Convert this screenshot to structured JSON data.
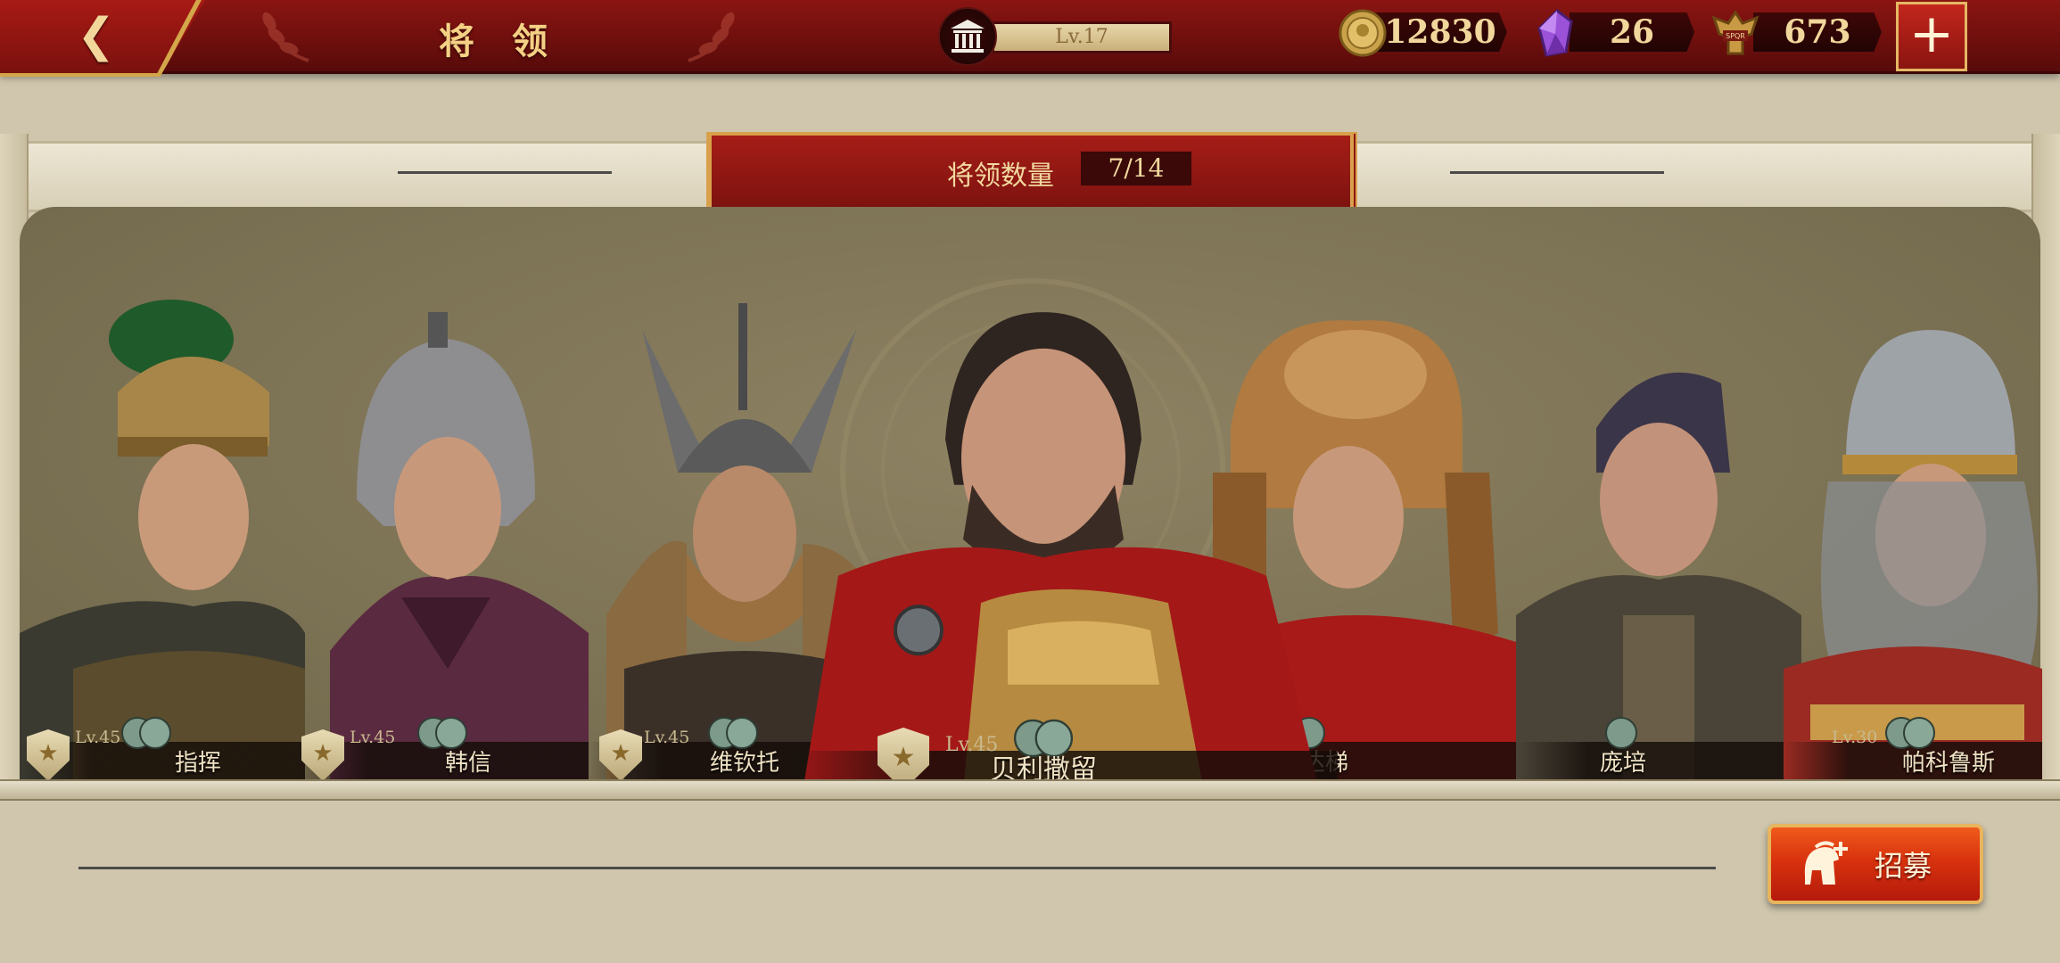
{
  "header": {
    "title": "将 领",
    "level_text": "Lv.17",
    "resources": [
      {
        "name": "gold-coin",
        "value": "12830"
      },
      {
        "name": "purple-gem",
        "value": "26"
      },
      {
        "name": "spqr-token",
        "value": "673"
      }
    ],
    "add_label": "+"
  },
  "panel": {
    "count_label": "将领数量",
    "count_value": "7/14"
  },
  "generals": [
    {
      "name": "指挥",
      "level": "Lv.45"
    },
    {
      "name": "韩信",
      "level": "Lv.45"
    },
    {
      "name": "维钦托",
      "level": "Lv.45"
    },
    {
      "name": "贝利撒留",
      "level": "Lv.45",
      "featured": true
    },
    {
      "name": "萨拉达梯",
      "level": ""
    },
    {
      "name": "庞培",
      "level": ""
    },
    {
      "name": "帕科鲁斯",
      "level": "Lv.30"
    }
  ],
  "recruit": {
    "label": "招募"
  },
  "colors": {
    "topbar": "#7a110e",
    "accent_gold": "#d9a04c",
    "panel_bg": "#cfc6ad",
    "recruit_orange": "#d8320e"
  }
}
